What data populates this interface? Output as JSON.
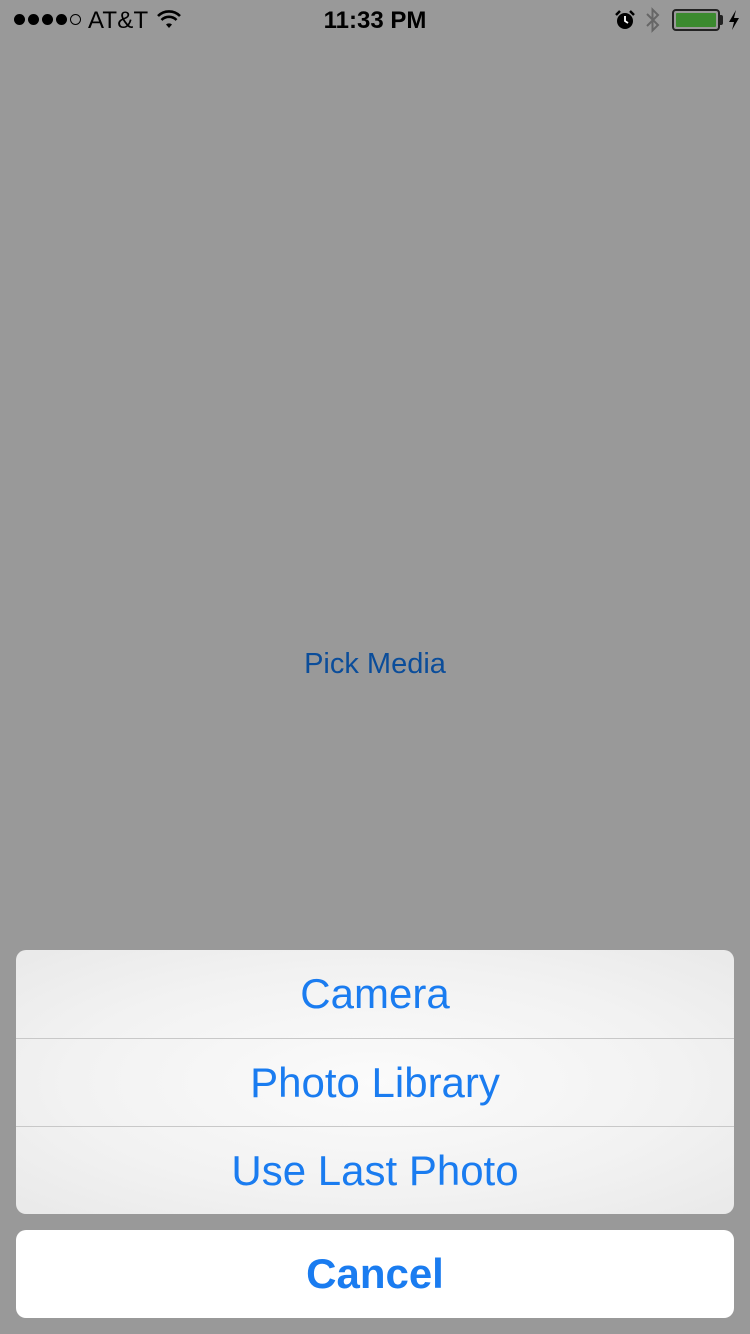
{
  "status_bar": {
    "carrier": "AT&T",
    "time": "11:33 PM",
    "signal_bars_filled": 4,
    "signal_bars_total": 5,
    "battery_level": 1.0,
    "icons": [
      "wifi-icon",
      "alarm-icon",
      "bluetooth-icon",
      "battery-icon",
      "charging-icon"
    ]
  },
  "main": {
    "pick_media_label": "Pick Media"
  },
  "action_sheet": {
    "options": [
      {
        "label": "Camera"
      },
      {
        "label": "Photo Library"
      },
      {
        "label": "Use Last Photo"
      }
    ],
    "cancel_label": "Cancel"
  },
  "colors": {
    "background_dim": "#999999",
    "tint": "#1a7cf0",
    "dimmed_tint": "#0b4d9a",
    "battery_green": "#3b8a2f"
  }
}
